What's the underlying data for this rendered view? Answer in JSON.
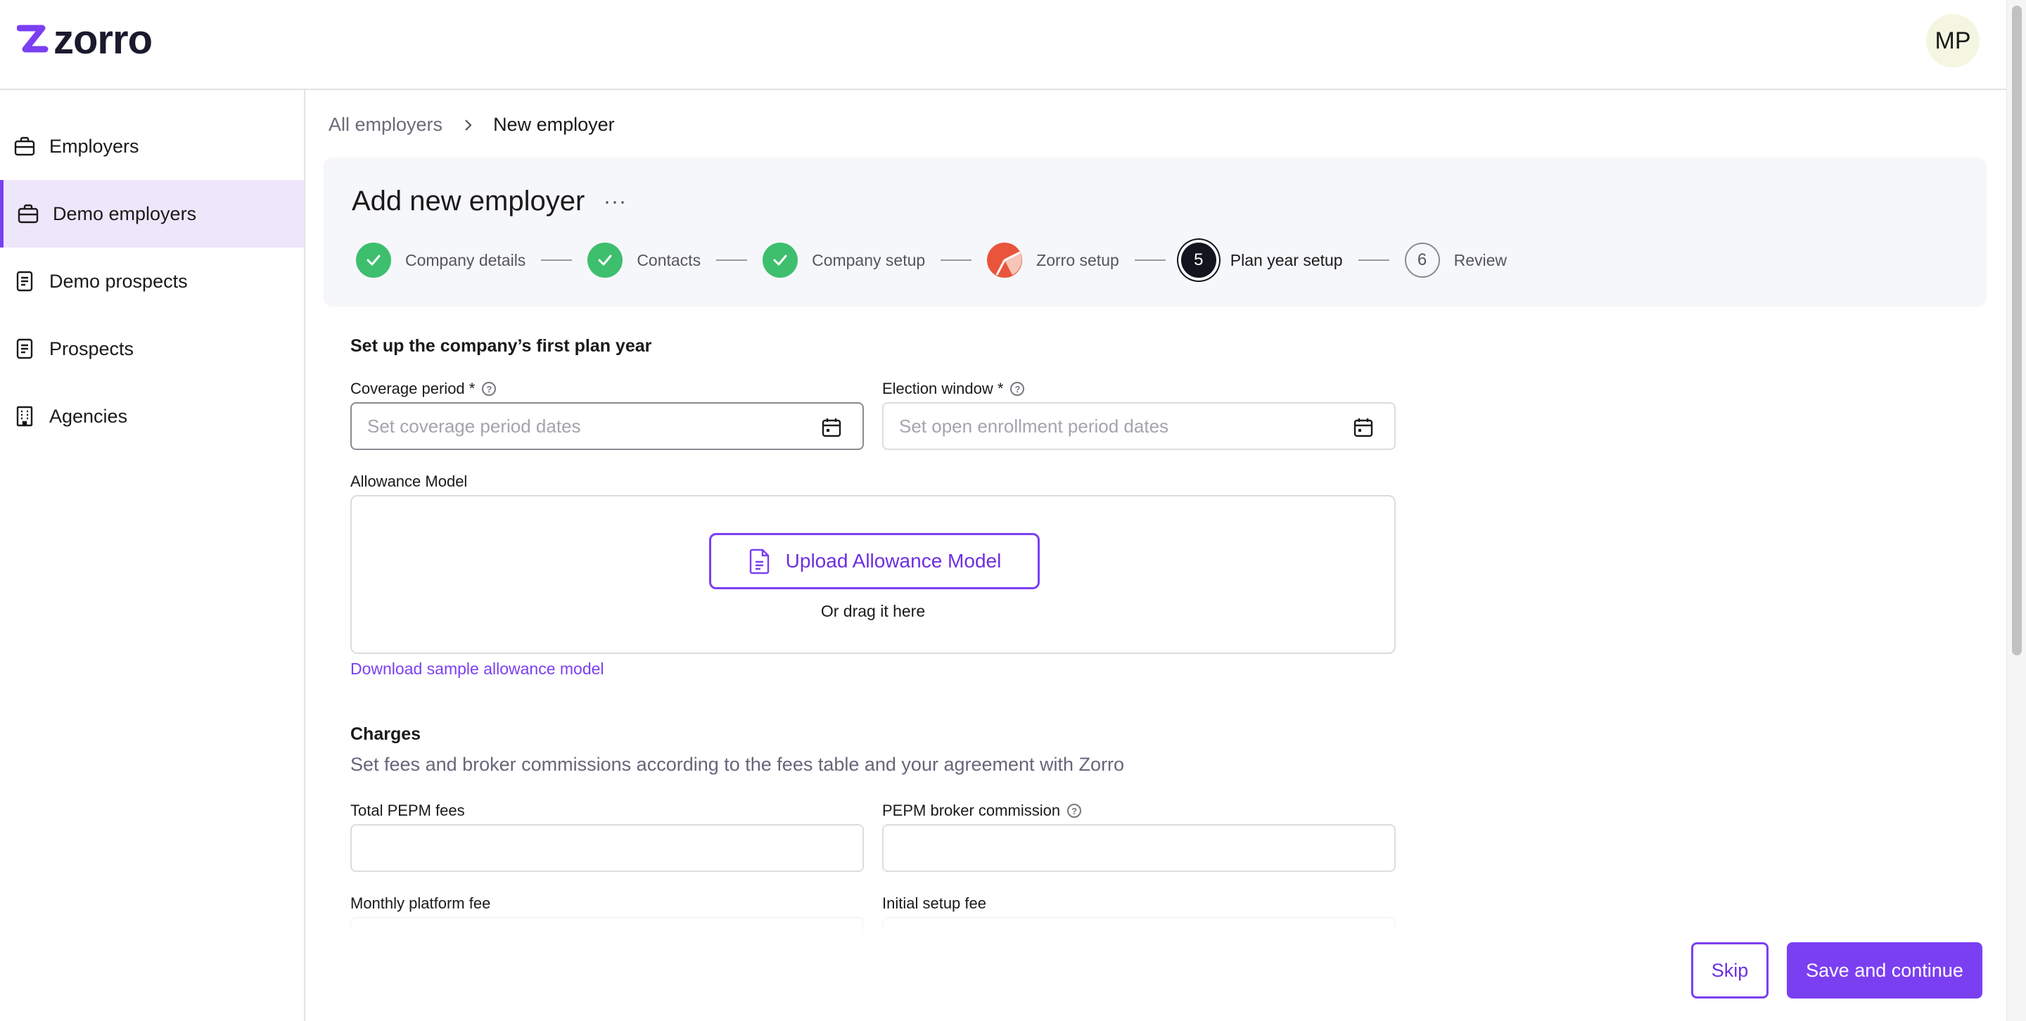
{
  "brand": {
    "name": "zorro",
    "accent": "#7b3ff2"
  },
  "user": {
    "initials": "MP"
  },
  "sidebar": {
    "items": [
      {
        "label": "Employers",
        "icon": "briefcase-icon",
        "active": false
      },
      {
        "label": "Demo employers",
        "icon": "briefcase-icon",
        "active": true
      },
      {
        "label": "Demo prospects",
        "icon": "document-icon",
        "active": false
      },
      {
        "label": "Prospects",
        "icon": "document-icon",
        "active": false
      },
      {
        "label": "Agencies",
        "icon": "building-icon",
        "active": false
      }
    ]
  },
  "breadcrumb": {
    "parent": "All employers",
    "current": "New employer"
  },
  "header": {
    "title": "Add new employer",
    "more": "···",
    "steps": [
      {
        "label": "Company details",
        "status": "done"
      },
      {
        "label": "Contacts",
        "status": "done"
      },
      {
        "label": "Company setup",
        "status": "done"
      },
      {
        "label": "Zorro setup",
        "status": "partial"
      },
      {
        "label": "Plan year setup",
        "status": "current",
        "number": "5"
      },
      {
        "label": "Review",
        "status": "todo",
        "number": "6"
      }
    ]
  },
  "form": {
    "section_title": "Set up the company’s first plan year",
    "coverage": {
      "label": "Coverage period *",
      "placeholder": "Set coverage period dates"
    },
    "election": {
      "label": "Election window *",
      "placeholder": "Set open enrollment period dates"
    },
    "allowance": {
      "label": "Allowance Model",
      "upload_label": "Upload Allowance Model",
      "drag_text": "Or drag it here",
      "sample_link": "Download sample allowance model"
    },
    "charges": {
      "title": "Charges",
      "subtitle": "Set fees and broker commissions according to the fees table and your agreement with Zorro",
      "total_pepm_label": "Total PEPM fees",
      "broker_commission_label": "PEPM broker commission",
      "monthly_platform_label": "Monthly platform fee",
      "initial_setup_label": "Initial setup fee"
    }
  },
  "actions": {
    "skip": "Skip",
    "save": "Save and continue"
  }
}
